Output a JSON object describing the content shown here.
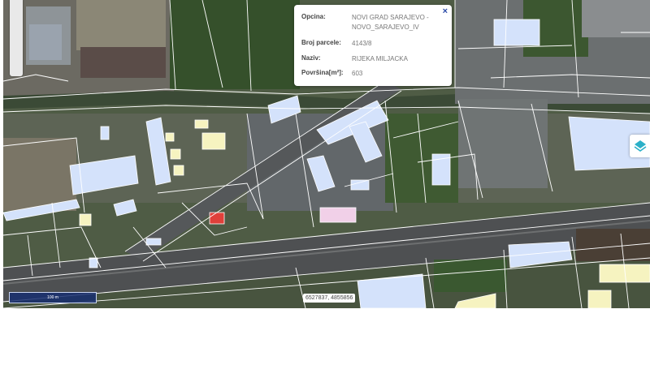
{
  "popup": {
    "rows": [
      {
        "label": "Opcina:",
        "value": "NOVI GRAD SARAJEVO - NOVO_SARAJEVO_IV"
      },
      {
        "label": "Broj parcele:",
        "value": "4143/8"
      },
      {
        "label": "Naziv:",
        "value": "RIJEKA MILJACKA"
      },
      {
        "label": "Površina[m²]:",
        "value": "603"
      }
    ],
    "close_label": "×"
  },
  "scale": {
    "label": "100 m"
  },
  "coordinates": {
    "value": "6527837, 4855856"
  },
  "layer_button": {
    "icon": "layers-icon"
  },
  "colors": {
    "parcel_line": "#ffffff",
    "building_blue": "#d4e2fb",
    "building_yellow": "#f6f3c0",
    "building_pink": "#f1d0e8",
    "building_red": "#e0403a",
    "vegetation": "#3e5a32",
    "road": "#4e5052",
    "layer_icon": "#2bb0c8"
  }
}
